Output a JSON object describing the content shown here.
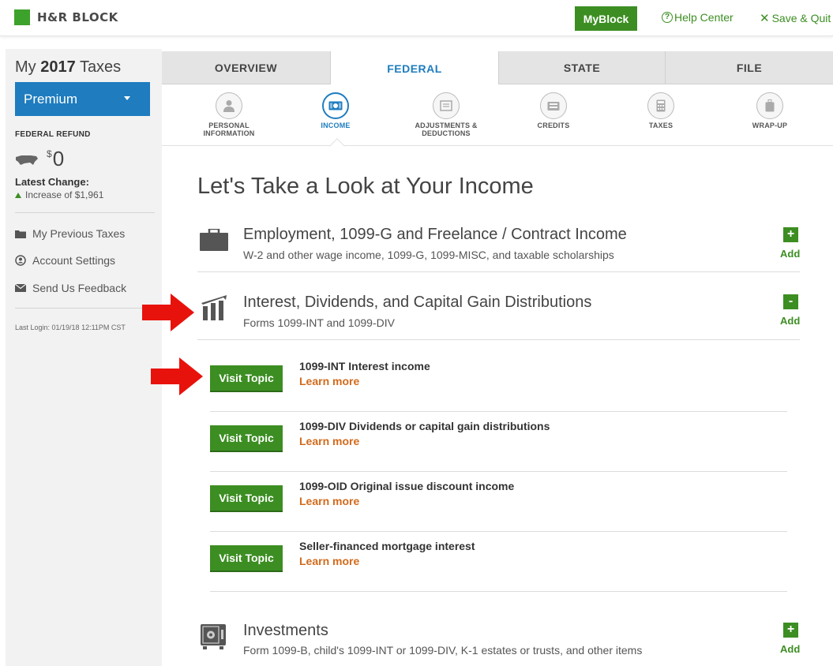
{
  "header": {
    "brand": "H&R BLOCK",
    "myblock_label": "MyBlock",
    "help_label": "Help Center",
    "save_label": "Save & Quit"
  },
  "sidebar": {
    "my_prefix": "My",
    "year": "2017",
    "taxes_word": "Taxes",
    "plan": "Premium",
    "refund_label": "FEDERAL REFUND",
    "refund_currency": "$",
    "refund_amount": "0",
    "latest_change_label": "Latest Change:",
    "latest_change_value": "Increase of $1,961",
    "links": [
      {
        "label": "My Previous Taxes",
        "icon": "folder-icon"
      },
      {
        "label": "Account Settings",
        "icon": "account-icon"
      },
      {
        "label": "Send Us Feedback",
        "icon": "envelope-icon"
      }
    ],
    "last_login": "Last Login: 01/19/18 12:11PM CST"
  },
  "tabs": [
    {
      "label": "OVERVIEW",
      "active": false
    },
    {
      "label": "FEDERAL",
      "active": true
    },
    {
      "label": "STATE",
      "active": false
    },
    {
      "label": "FILE",
      "active": false
    }
  ],
  "subnav": [
    {
      "line1": "PERSONAL",
      "line2": "INFORMATION",
      "icon": "person-icon",
      "active": false
    },
    {
      "line1": "INCOME",
      "line2": "",
      "icon": "money-icon",
      "active": true
    },
    {
      "line1": "ADJUSTMENTS &",
      "line2": "DEDUCTIONS",
      "icon": "form-icon",
      "active": false
    },
    {
      "line1": "CREDITS",
      "line2": "",
      "icon": "wallet-icon",
      "active": false
    },
    {
      "line1": "TAXES",
      "line2": "",
      "icon": "calculator-icon",
      "active": false
    },
    {
      "line1": "WRAP-UP",
      "line2": "",
      "icon": "bag-icon",
      "active": false
    }
  ],
  "main": {
    "title": "Let's Take a Look at Your Income",
    "sections": [
      {
        "title": "Employment, 1099-G and Freelance / Contract Income",
        "subtitle": "W-2 and other wage income, 1099-G, 1099-MISC, and taxable scholarships",
        "toggle": "+",
        "add_label": "Add",
        "icon": "briefcase-icon"
      },
      {
        "title": "Interest, Dividends, and Capital Gain Distributions",
        "subtitle": "Forms 1099-INT and 1099-DIV",
        "toggle": "-",
        "add_label": "Add",
        "icon": "bank-icon"
      },
      {
        "title": "Investments",
        "subtitle": "Form 1099-B, child's 1099-INT or 1099-DIV, K-1 estates or trusts, and other items",
        "toggle": "+",
        "add_label": "Add",
        "icon": "safe-icon"
      }
    ],
    "topics": [
      {
        "button": "Visit Topic",
        "title": "1099-INT Interest income",
        "learn": "Learn more"
      },
      {
        "button": "Visit Topic",
        "title": "1099-DIV Dividends or capital gain distributions",
        "learn": "Learn more"
      },
      {
        "button": "Visit Topic",
        "title": "1099-OID Original issue discount income",
        "learn": "Learn more"
      },
      {
        "button": "Visit Topic",
        "title": "Seller-financed mortgage interest",
        "learn": "Learn more"
      }
    ]
  },
  "colors": {
    "brand_green": "#3c8e22",
    "logo_green": "#3da22b",
    "primary_blue": "#1e7cbf",
    "learn_orange": "#d26a1c",
    "arrow_red": "#e8120c"
  }
}
